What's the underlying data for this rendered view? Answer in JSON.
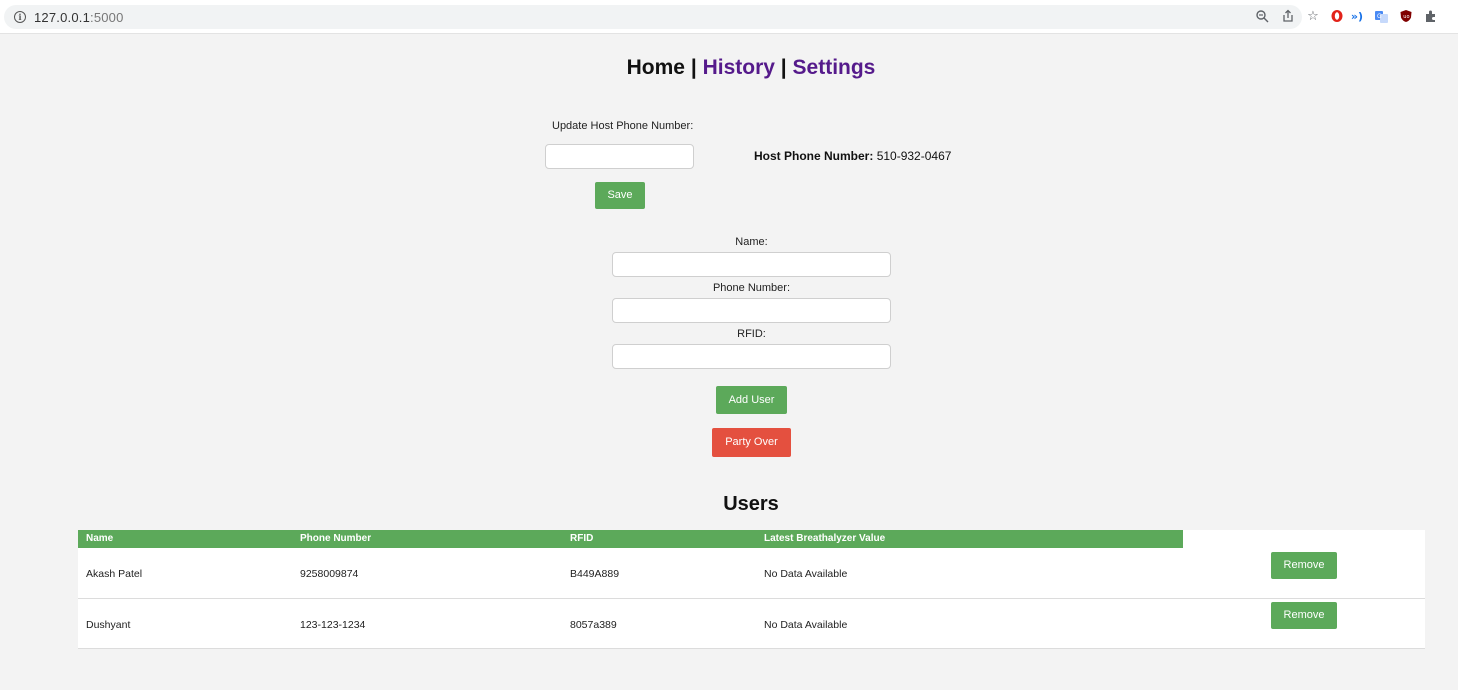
{
  "browser": {
    "url_host": "127.0.0.1",
    "url_port": ":5000",
    "icons": [
      "info-icon",
      "zoom-icon",
      "share-icon",
      "bookmark-star-icon",
      "opera-icon",
      "reader-icon",
      "translate-icon",
      "ublock-icon",
      "extensions-icon"
    ]
  },
  "nav": {
    "home": "Home",
    "separator": "|",
    "history": "History",
    "settings": "Settings"
  },
  "host_form": {
    "label": "Update Host Phone Number:",
    "input_value": "",
    "save_label": "Save",
    "current_label": "Host Phone Number:",
    "current_value": "510-932-0467"
  },
  "user_form": {
    "name_label": "Name:",
    "name_value": "",
    "phone_label": "Phone Number:",
    "phone_value": "",
    "rfid_label": "RFID:",
    "rfid_value": "",
    "add_label": "Add User",
    "party_over_label": "Party Over"
  },
  "users": {
    "title": "Users",
    "columns": [
      "Name",
      "Phone Number",
      "RFID",
      "Latest Breathalyzer Value"
    ],
    "rows": [
      {
        "name": "Akash Patel",
        "phone": "9258009874",
        "rfid": "B449A889",
        "value": "No Data Available",
        "action": "Remove"
      },
      {
        "name": "Dushyant",
        "phone": "123-123-1234",
        "rfid": "8057a389",
        "value": "No Data Available",
        "action": "Remove"
      }
    ]
  },
  "colors": {
    "accent_green": "#5ca95a",
    "danger_red": "#e4503f",
    "link_purple": "#551a8b"
  }
}
